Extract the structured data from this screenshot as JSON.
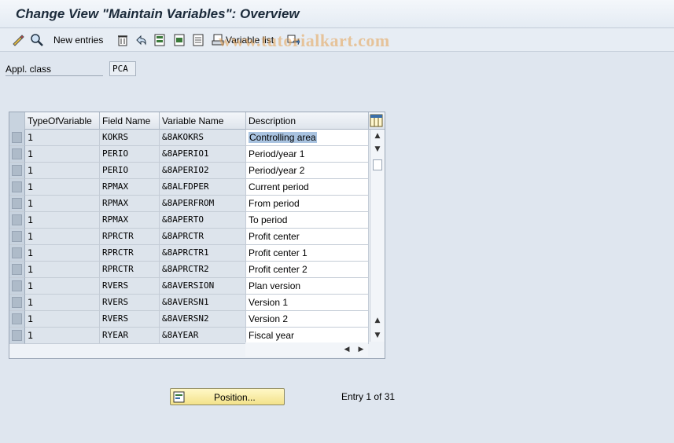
{
  "title": "Change View \"Maintain Variables\": Overview",
  "toolbar": {
    "new_entries_label": "New entries",
    "variable_list_label": "Variable list"
  },
  "watermark": "www.tutorialkart.com",
  "field": {
    "label": "Appl. class",
    "value": "PCA"
  },
  "table": {
    "columns": [
      "TypeOfVariable",
      "Field Name",
      "Variable Name",
      "Description"
    ],
    "rows": [
      {
        "type": "1",
        "field": "KOKRS",
        "variable": "&8AKOKRS",
        "desc": "Controlling area"
      },
      {
        "type": "1",
        "field": "PERIO",
        "variable": "&8APERIO1",
        "desc": "Period/year 1"
      },
      {
        "type": "1",
        "field": "PERIO",
        "variable": "&8APERIO2",
        "desc": "Period/year 2"
      },
      {
        "type": "1",
        "field": "RPMAX",
        "variable": "&8ALFDPER",
        "desc": "Current period"
      },
      {
        "type": "1",
        "field": "RPMAX",
        "variable": "&8APERFROM",
        "desc": "From period"
      },
      {
        "type": "1",
        "field": "RPMAX",
        "variable": "&8APERTO",
        "desc": "To period"
      },
      {
        "type": "1",
        "field": "RPRCTR",
        "variable": "&8APRCTR",
        "desc": "Profit center"
      },
      {
        "type": "1",
        "field": "RPRCTR",
        "variable": "&8APRCTR1",
        "desc": "Profit center 1"
      },
      {
        "type": "1",
        "field": "RPRCTR",
        "variable": "&8APRCTR2",
        "desc": "Profit center 2"
      },
      {
        "type": "1",
        "field": "RVERS",
        "variable": "&8AVERSION",
        "desc": "Plan version"
      },
      {
        "type": "1",
        "field": "RVERS",
        "variable": "&8AVERSN1",
        "desc": "Version 1"
      },
      {
        "type": "1",
        "field": "RVERS",
        "variable": "&8AVERSN2",
        "desc": "Version 2"
      },
      {
        "type": "1",
        "field": "RYEAR",
        "variable": "&8AYEAR",
        "desc": "Fiscal year"
      }
    ]
  },
  "position_button_label": "Position...",
  "entry_info": "Entry 1 of 31",
  "colors": {
    "accent": "#a9c3e0",
    "button": "#f3e28a"
  }
}
